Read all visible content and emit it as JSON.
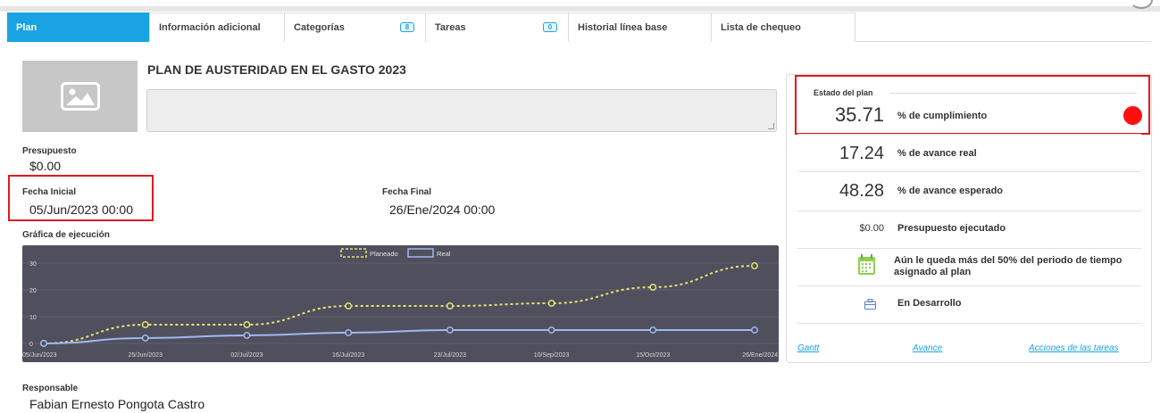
{
  "tabs": [
    {
      "label": "Plan",
      "badge": null,
      "active": true
    },
    {
      "label": "Información adicional",
      "badge": null,
      "active": false
    },
    {
      "label": "Categorías",
      "badge": "8",
      "active": false
    },
    {
      "label": "Tareas",
      "badge": "0",
      "active": false
    },
    {
      "label": "Historial línea base",
      "badge": null,
      "active": false
    },
    {
      "label": "Lista de chequeo",
      "badge": null,
      "active": false
    }
  ],
  "plan": {
    "title": "PLAN DE AUSTERIDAD EN EL GASTO 2023",
    "description": "",
    "image_icon": "image-placeholder-icon"
  },
  "fields": {
    "budget_label": "Presupuesto",
    "budget_value": "$0.00",
    "start_label": "Fecha Inicial",
    "start_value": "05/Jun/2023 00:00",
    "end_label": "Fecha Final",
    "end_value": "26/Ene/2024 00:00",
    "chart_label": "Gráfica de ejecución",
    "owner_label": "Responsable",
    "owner_value": "Fabian Ernesto Pongota Castro"
  },
  "chart_data": {
    "type": "line",
    "x": [
      "05/Jun/2023",
      "25/Jun/2023",
      "02/Jul/2023",
      "16/Jul/2023",
      "23/Jul/2023",
      "10/Sep/2023",
      "15/Oct/2023",
      "26/Ene/2024"
    ],
    "series": [
      {
        "name": "Planeado",
        "values": [
          0,
          7,
          7,
          14,
          14,
          15,
          21,
          29
        ],
        "color": "#e8e373",
        "style": "dashed"
      },
      {
        "name": "Real",
        "values": [
          0,
          2,
          3,
          4,
          5,
          5,
          5,
          5
        ],
        "color": "#9fb8f0",
        "style": "solid"
      }
    ],
    "yticks": [
      0,
      10,
      20,
      30
    ],
    "ylim": [
      0,
      32
    ],
    "legend": "top-center",
    "grid": true,
    "background": "#504f5d"
  },
  "status": {
    "title": "Estado del plan",
    "rows": [
      {
        "value": "35.71",
        "label": "% de cumplimiento"
      },
      {
        "value": "17.24",
        "label": "% de avance real"
      },
      {
        "value": "48.28",
        "label": "% de avance esperado"
      },
      {
        "value": "$0.00",
        "label": "Presupuesto ejecutado"
      }
    ],
    "indicator_color": "#ff1010",
    "period_text": "Aún le queda más del 50% del periodo de tiempo asignado al plan",
    "period_icon": "calendar-icon",
    "state_text": "En Desarrollo",
    "state_icon": "briefcase-icon",
    "links": [
      "Gantt",
      "Avance",
      "Acciones de las tareas"
    ]
  }
}
